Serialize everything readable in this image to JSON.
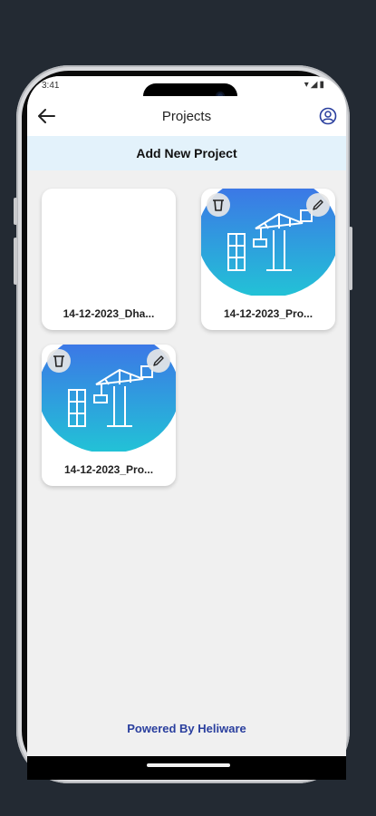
{
  "status": {
    "time": "3:41",
    "indicators": "▾◢▮"
  },
  "appbar": {
    "title": "Projects",
    "back_icon": "arrow-left-icon",
    "profile_icon": "user-circle-icon"
  },
  "add_project": {
    "label": "Add New Project"
  },
  "projects": [
    {
      "name": "14-12-2023_Dha...",
      "has_image": false
    },
    {
      "name": "14-12-2023_Pro...",
      "has_image": true
    },
    {
      "name": "14-12-2023_Pro...",
      "has_image": true
    }
  ],
  "footer": {
    "powered_by": "Powered By Heliware"
  },
  "colors": {
    "accent_blue": "#2a3f9e",
    "add_bar_bg": "#e3f2fb",
    "thumb_top": "#3f6ee8",
    "thumb_bottom": "#22c3d6"
  }
}
